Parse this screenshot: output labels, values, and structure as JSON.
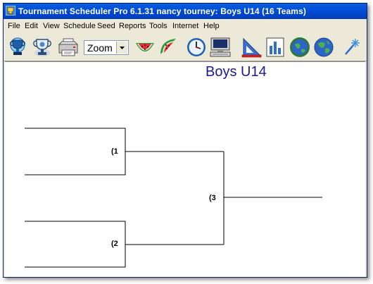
{
  "window": {
    "title": "Tournament Scheduler Pro 6.1.31 nancy tourney: Boys U14 (16 Teams)"
  },
  "menu": [
    {
      "label": "File"
    },
    {
      "label": "Edit"
    },
    {
      "label": "View"
    },
    {
      "label": "Schedule"
    },
    {
      "label": "Seed"
    },
    {
      "label": "Reports"
    },
    {
      "label": "Tools"
    },
    {
      "label": "Internet"
    },
    {
      "label": "Help"
    }
  ],
  "toolbar": {
    "zoom_value": "Zoom",
    "buttons": [
      {
        "icon": "trophy-icon"
      },
      {
        "icon": "trophy-outline-icon"
      },
      {
        "icon": "printer-icon"
      },
      {
        "icon": "watermelon-icon"
      },
      {
        "icon": "watermelon-slice-icon"
      },
      {
        "icon": "clock-icon"
      },
      {
        "icon": "computer-icon"
      },
      {
        "icon": "drafting-triangle-icon"
      },
      {
        "icon": "bar-chart-icon"
      },
      {
        "icon": "globe-gear-icon"
      },
      {
        "icon": "globe-icon"
      },
      {
        "icon": "wand-sparkle-icon"
      }
    ]
  },
  "bracket": {
    "title": "Boys U14",
    "matches": [
      {
        "label": "(1"
      },
      {
        "label": "(2"
      },
      {
        "label": "(3"
      }
    ]
  },
  "colors": {
    "title_bar": "#0048d0",
    "bracket_title": "#1c1a93",
    "chrome": "#ece9d8"
  }
}
